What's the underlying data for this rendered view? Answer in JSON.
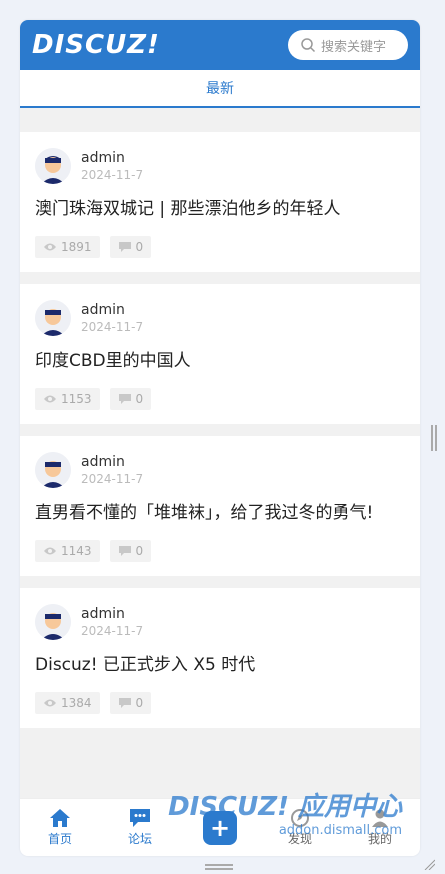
{
  "header": {
    "logo": "DISCUZ!",
    "search_placeholder": "搜索关键字"
  },
  "tabs": [
    {
      "label": "最新"
    }
  ],
  "posts": [
    {
      "author": "admin",
      "date": "2024-11-7",
      "title": "澳门珠海双城记 | 那些漂泊他乡的年轻人",
      "views": "1891",
      "replies": "0"
    },
    {
      "author": "admin",
      "date": "2024-11-7",
      "title": "印度CBD里的中国人",
      "views": "1153",
      "replies": "0"
    },
    {
      "author": "admin",
      "date": "2024-11-7",
      "title": "直男看不懂的「堆堆袜」，给了我过冬的勇气!",
      "views": "1143",
      "replies": "0"
    },
    {
      "author": "admin",
      "date": "2024-11-7",
      "title": "Discuz! 已正式步入 X5 时代",
      "views": "1384",
      "replies": "0"
    }
  ],
  "footer": {
    "items": [
      {
        "label": "首页",
        "icon": "home-icon"
      },
      {
        "label": "论坛",
        "icon": "chat-icon"
      },
      {
        "label": "",
        "icon": "plus-icon"
      },
      {
        "label": "发现",
        "icon": "discover-icon"
      },
      {
        "label": "我的",
        "icon": "user-icon"
      }
    ]
  },
  "watermark": {
    "main": "DISCUZ! 应用中心",
    "sub": "addon.dismall.com"
  },
  "colors": {
    "accent": "#2b7acd"
  }
}
